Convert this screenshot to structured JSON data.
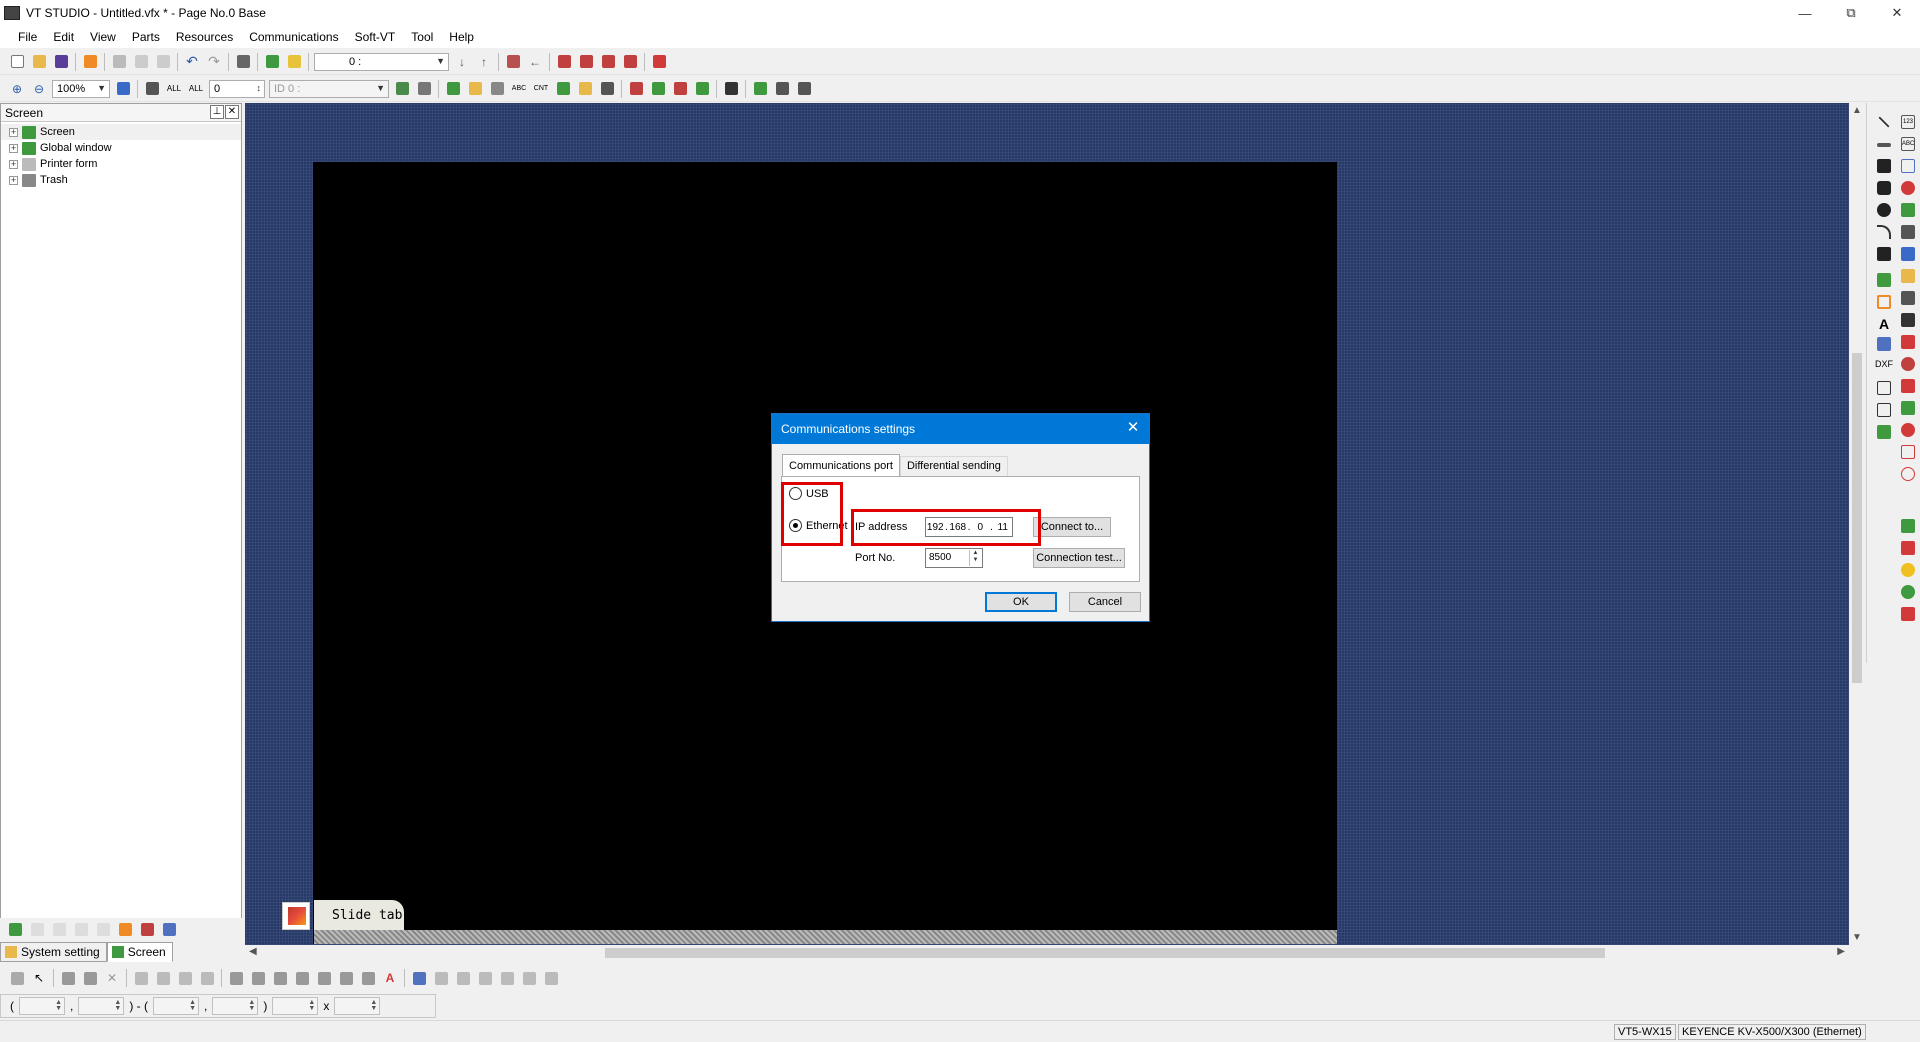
{
  "window": {
    "title": "VT STUDIO - Untitled.vfx * - Page No.0 Base"
  },
  "menu": [
    "File",
    "Edit",
    "View",
    "Parts",
    "Resources",
    "Communications",
    "Soft-VT",
    "Tool",
    "Help"
  ],
  "toolbar1": {
    "page_combo": "0 :"
  },
  "toolbar2": {
    "zoom": "100%",
    "layer": "0",
    "id_combo": "ID 0 :"
  },
  "panel": {
    "title": "Screen",
    "tree": [
      {
        "label": "Screen",
        "icon": "screen-icon"
      },
      {
        "label": "Global window",
        "icon": "global-window-icon"
      },
      {
        "label": "Printer form",
        "icon": "printer-icon"
      },
      {
        "label": "Trash",
        "icon": "trash-icon"
      }
    ],
    "tabs": [
      "System setting",
      "Screen"
    ]
  },
  "canvas": {
    "slide_tab": "Slide tab"
  },
  "dialog": {
    "title": "Communications settings",
    "tabs": [
      "Communications port",
      "Differential sending"
    ],
    "usb_label": "USB",
    "ethernet_label": "Ethernet",
    "selected": "Ethernet",
    "ip_label": "IP address",
    "ip": [
      "192",
      "168",
      "0",
      "11"
    ],
    "port_label": "Port No.",
    "port_value": "8500",
    "connect_to": "Connect to...",
    "connection_test": "Connection test...",
    "ok": "OK",
    "cancel": "Cancel"
  },
  "statusbar": {
    "model": "VT5-WX15",
    "plc": "KEYENCE KV-X500/X300 (Ethernet)"
  },
  "colors": {
    "accent": "#0078d7",
    "highlight": "#e00000",
    "canvas": "#283a66"
  }
}
